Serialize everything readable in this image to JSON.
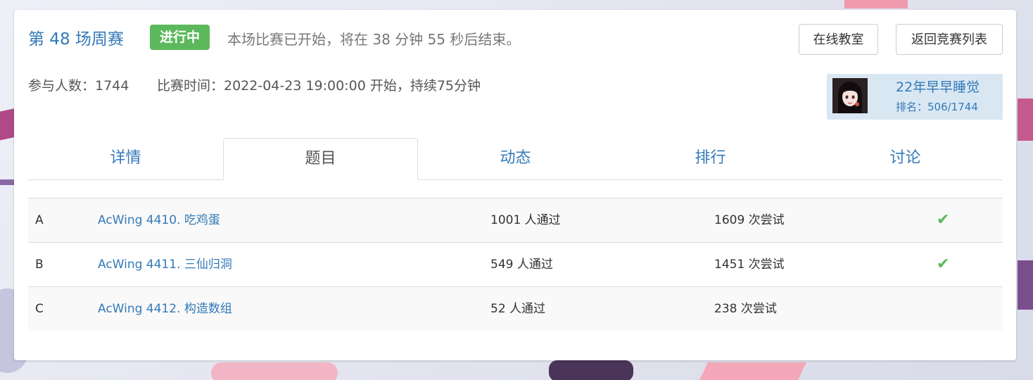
{
  "contest": {
    "title": "第 48 场周赛",
    "badge": "进行中",
    "status_text": "本场比赛已开始，将在 38 分钟 55 秒后结束。",
    "participants_label": "参与人数：1744",
    "time_label": "比赛时间：2022-04-23 19:00:00 开始，持续75分钟"
  },
  "buttons": {
    "classroom": "在线教室",
    "back_to_list": "返回竞赛列表"
  },
  "user": {
    "name": "22年早早睡觉",
    "rank": "排名：506/1744"
  },
  "tabs": [
    {
      "label": "详情",
      "active": false
    },
    {
      "label": "题目",
      "active": true
    },
    {
      "label": "动态",
      "active": false
    },
    {
      "label": "排行",
      "active": false
    },
    {
      "label": "讨论",
      "active": false
    }
  ],
  "problems": [
    {
      "id": "A",
      "name": "AcWing 4410. 吃鸡蛋",
      "passed": "1001 人通过",
      "tries": "1609 次尝试",
      "solved": "✔"
    },
    {
      "id": "B",
      "name": "AcWing 4411. 三仙归洞",
      "passed": "549 人通过",
      "tries": "1451 次尝试",
      "solved": "✔"
    },
    {
      "id": "C",
      "name": "AcWing 4412. 构造数组",
      "passed": "52 人通过",
      "tries": "238 次尝试",
      "solved": ""
    }
  ],
  "colors": {
    "link": "#337ab7",
    "success": "#5cb85c",
    "user_box_bg": "#d9e7f3"
  }
}
